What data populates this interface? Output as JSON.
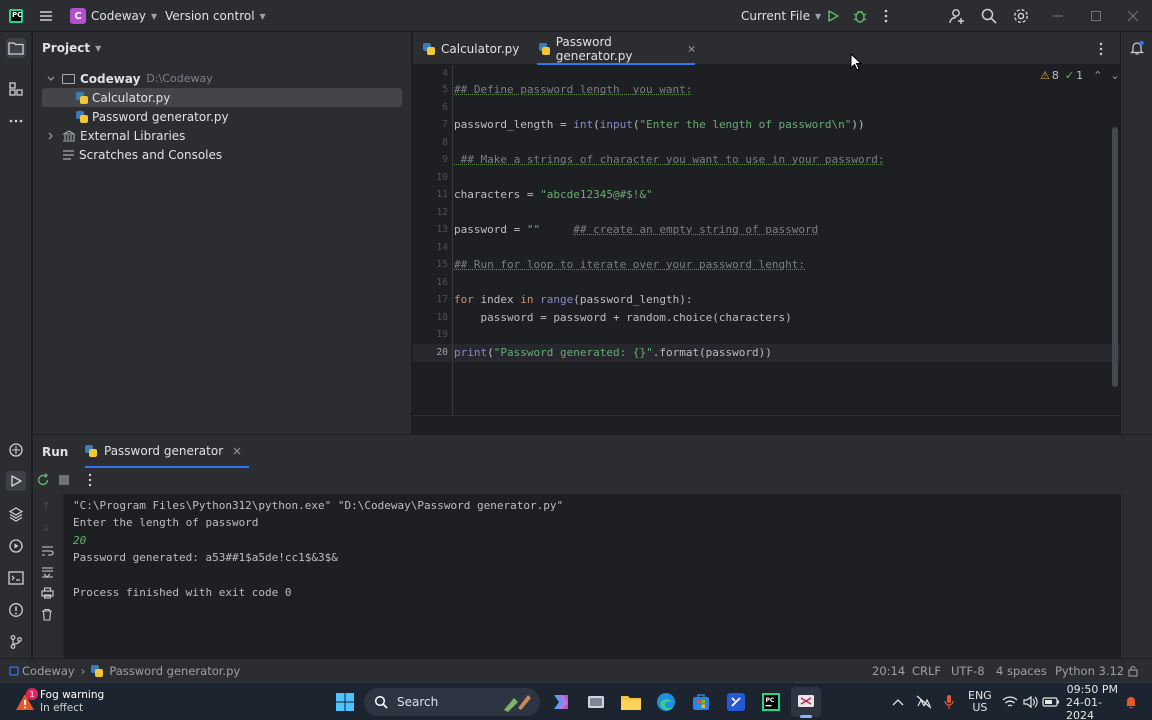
{
  "titlebar": {
    "logo_letters": "PC",
    "project_badge": "C",
    "project_name": "Codeway",
    "vcs_label": "Version control",
    "run_config": "Current File"
  },
  "project_panel": {
    "title": "Project",
    "root": {
      "name": "Codeway",
      "path": "D:\\Codeway"
    },
    "files": [
      {
        "name": "Calculator.py"
      },
      {
        "name": "Password generator.py"
      }
    ],
    "external_libraries": "External Libraries",
    "scratches": "Scratches and Consoles"
  },
  "editor": {
    "tabs": [
      {
        "label": "Calculator.py"
      },
      {
        "label": "Password generator.py"
      }
    ],
    "inspections": {
      "warnings": "8",
      "weak": "1"
    },
    "line_numbers": [
      "4",
      "5",
      "6",
      "7",
      "8",
      "9",
      "10",
      "11",
      "12",
      "13",
      "14",
      "15",
      "16",
      "17",
      "18",
      "19",
      "20"
    ],
    "code": {
      "l5": "## Define password length  you want:",
      "l7_var": "password_length = ",
      "l7_int": "int",
      "l7_p1": "(",
      "l7_input": "input",
      "l7_p2": "(",
      "l7_str": "\"Enter the length of password\\n\"",
      "l7_end": "))",
      "l9": " ## Make a strings of character you want to use in your password:",
      "l11_var": "characters = ",
      "l11_str": "\"abcde12345@#$!&\"",
      "l13_var": "password = ",
      "l13_str": "\"\"",
      "l13_cmt": "## create an empty string of password",
      "l15": "## Run for loop to iterate over your password lenght:",
      "l17_for": "for",
      "l17_mid": " index ",
      "l17_in": "in",
      "l17_sp": " ",
      "l17_range": "range",
      "l17_end": "(password_length):",
      "l18": "    password = password + random.choice(characters)",
      "l20_print": "print",
      "l20_p": "(",
      "l20_str": "\"Password generated: {}\"",
      "l20_end": ".format(password))"
    }
  },
  "run_panel": {
    "title": "Run",
    "tab_label": "Password generator",
    "output": {
      "cmd": "\"C:\\Program Files\\Python312\\python.exe\" \"D:\\Codeway\\Password generator.py\"",
      "prompt": "Enter the length of password",
      "input": "20",
      "result": "Password generated: a53##1$a5de!cc1$&3$&",
      "exit": "Process finished with exit code 0"
    }
  },
  "statusbar": {
    "breadcrumb_project": "Codeway",
    "breadcrumb_file": "Password generator.py",
    "position": "20:14",
    "line_sep": "CRLF",
    "encoding": "UTF-8",
    "indent": "4 spaces",
    "interpreter": "Python 3.12"
  },
  "taskbar": {
    "weather_badge": "1",
    "weather_title": "Fog warning",
    "weather_sub": "In effect",
    "search_label": "Search",
    "lang_top": "ENG",
    "lang_bottom": "US",
    "time": "09:50 PM",
    "date": "24-01-2024"
  },
  "colors": {
    "accent": "#3574f0",
    "run_green": "#5fb865",
    "pycharm_green": "#21d789"
  }
}
